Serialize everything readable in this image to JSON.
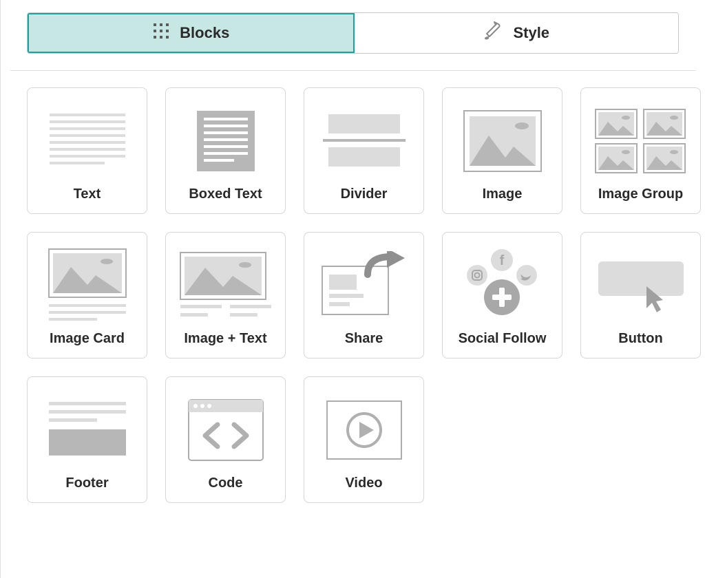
{
  "tabs": {
    "blocks": "Blocks",
    "style": "Style"
  },
  "blocks": [
    {
      "id": "text",
      "label": "Text"
    },
    {
      "id": "boxed-text",
      "label": "Boxed Text"
    },
    {
      "id": "divider",
      "label": "Divider"
    },
    {
      "id": "image",
      "label": "Image"
    },
    {
      "id": "image-group",
      "label": "Image Group"
    },
    {
      "id": "image-card",
      "label": "Image Card"
    },
    {
      "id": "image-text",
      "label": "Image + Text"
    },
    {
      "id": "share",
      "label": "Share"
    },
    {
      "id": "social-follow",
      "label": "Social Follow"
    },
    {
      "id": "button",
      "label": "Button"
    },
    {
      "id": "footer",
      "label": "Footer"
    },
    {
      "id": "code",
      "label": "Code"
    },
    {
      "id": "video",
      "label": "Video"
    }
  ]
}
